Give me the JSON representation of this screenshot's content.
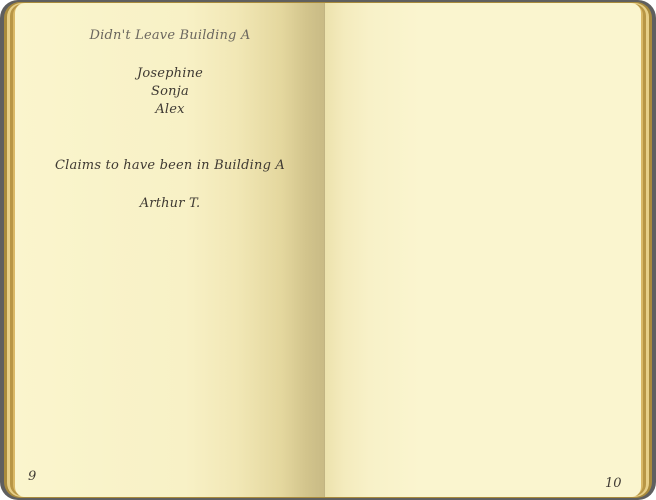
{
  "notebook": {
    "left_page": {
      "heading_1": "Didn't Leave Building A",
      "names_1": [
        "Josephine",
        "Sonja",
        "Alex"
      ],
      "heading_2": "Claims to have been in Building A",
      "names_2": [
        "Arthur T."
      ],
      "page_number": "9"
    },
    "right_page": {
      "page_number": "10"
    }
  }
}
